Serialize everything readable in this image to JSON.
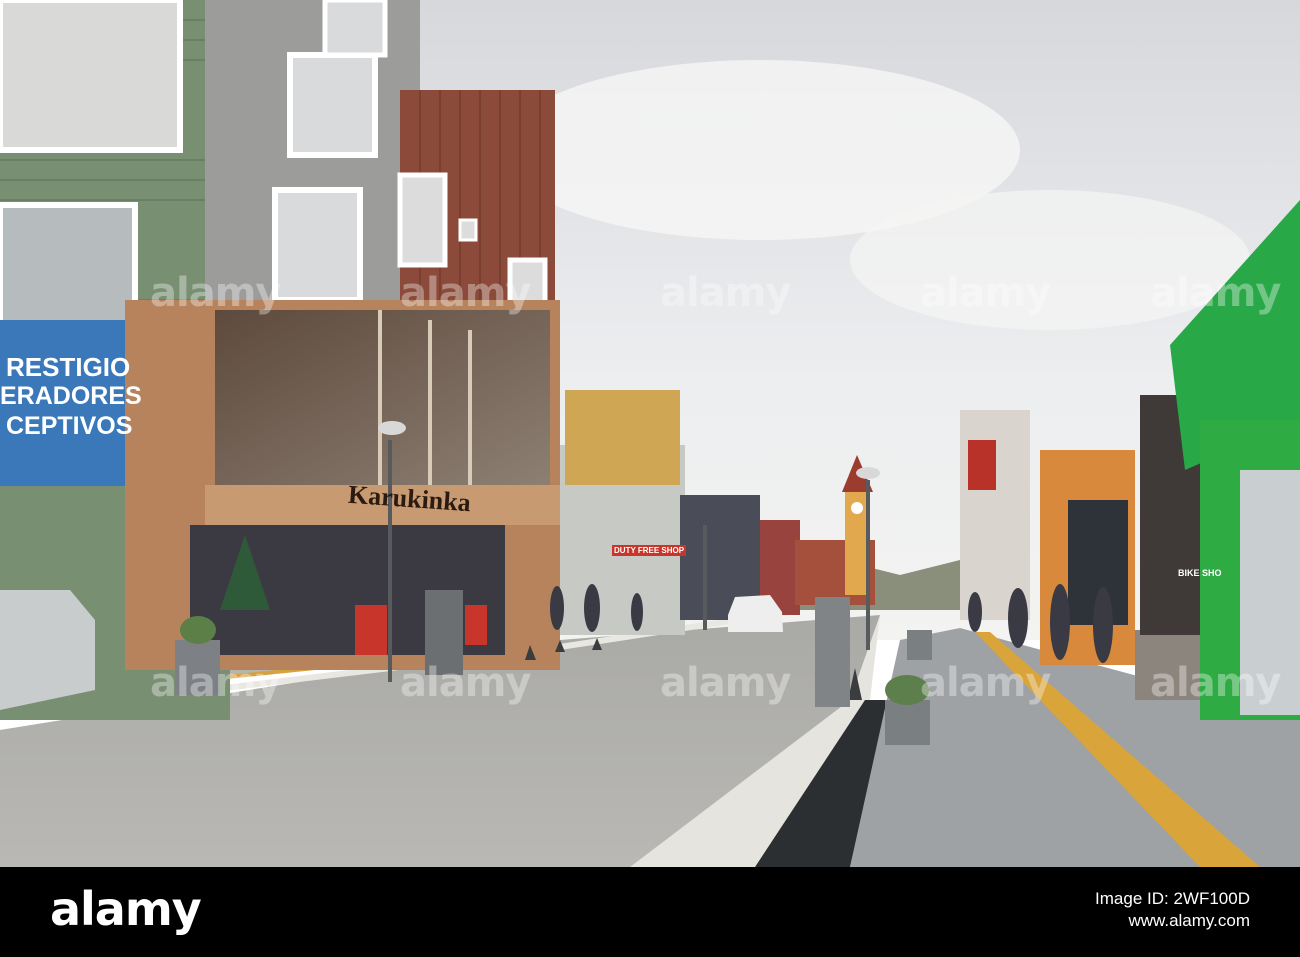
{
  "scene": {
    "billboard": {
      "line1": "RESTIGIO",
      "line2": "ERADORES",
      "line3": "CEPTIVOS"
    },
    "store_sign": "Karukinka",
    "right_shop_sign": "BIKE SHO",
    "duty_free_sign": "DUTY FREE SHOP"
  },
  "watermark": {
    "text": "alamy"
  },
  "footer": {
    "logo": "alamy",
    "image_id_label": "Image ID: 2WF100D",
    "site": "www.alamy.com"
  }
}
